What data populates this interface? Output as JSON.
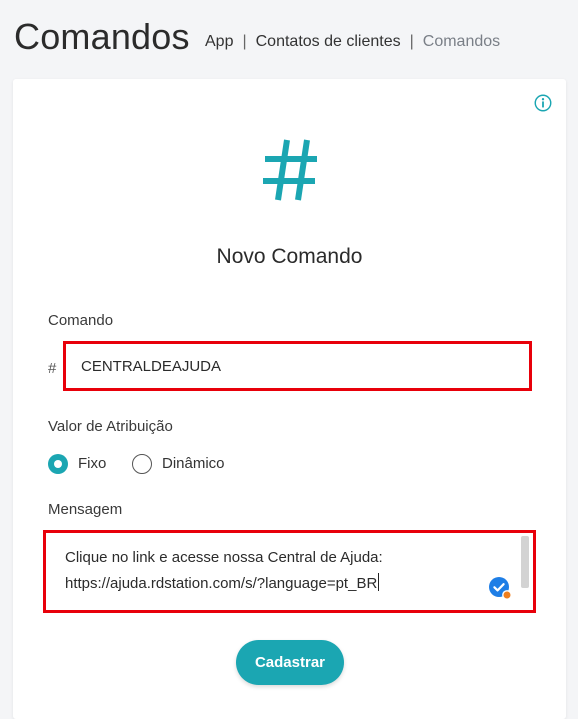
{
  "header": {
    "title": "Comandos",
    "breadcrumb": [
      "App",
      "Contatos de clientes",
      "Comandos"
    ]
  },
  "form": {
    "title": "Novo Comando",
    "icons": {
      "info": "info-icon",
      "header": "hash-icon",
      "spellcheck": "grammar-check-icon"
    },
    "command": {
      "label": "Comando",
      "prefix": "#",
      "value": "CENTRALDEAJUDA"
    },
    "assignment": {
      "label": "Valor de Atribuição",
      "options": [
        {
          "label": "Fixo",
          "checked": true
        },
        {
          "label": "Dinâmico",
          "checked": false
        }
      ]
    },
    "message": {
      "label": "Mensagem",
      "lines": [
        "Clique no link e acesse nossa Central de Ajuda:",
        "https://ajuda.rdstation.com/s/?language=pt_BR"
      ]
    },
    "submit_label": "Cadastrar"
  },
  "colors": {
    "accent": "#1ba6b2",
    "highlight_border": "#e8000a",
    "grammar_blue": "#1e7ee6",
    "grammar_orange": "#f07f1e"
  }
}
